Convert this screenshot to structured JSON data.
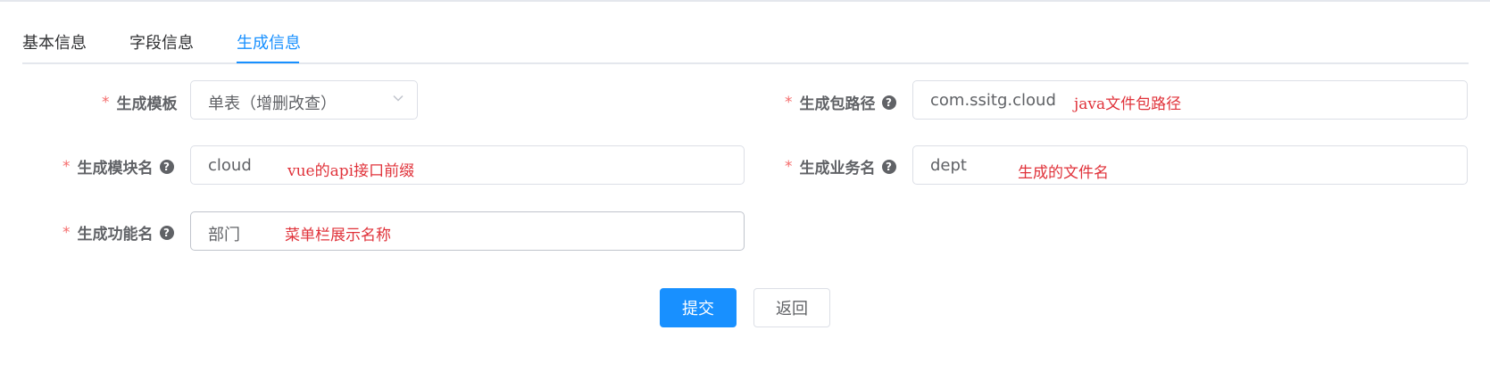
{
  "tabs": [
    {
      "label": "基本信息"
    },
    {
      "label": "字段信息"
    },
    {
      "label": "生成信息"
    }
  ],
  "active_tab": "生成信息",
  "form": {
    "required_mark": "*",
    "help_glyph": "?",
    "template": {
      "label": "生成模板",
      "value": "单表（增删改查）"
    },
    "package": {
      "label": "生成包路径",
      "value": "com.ssitg.cloud",
      "note": "java文件包路径"
    },
    "module": {
      "label": "生成模块名",
      "value": "cloud",
      "note": "vue的api接口前缀"
    },
    "business": {
      "label": "生成业务名",
      "value": "dept",
      "note": "生成的文件名"
    },
    "function": {
      "label": "生成功能名",
      "value": "部门",
      "note": "菜单栏展示名称"
    }
  },
  "buttons": {
    "submit": "提交",
    "back": "返回"
  },
  "colors": {
    "primary": "#1890ff",
    "required": "#f56c6c",
    "annotation": "#e0323a",
    "text": "#606266",
    "border": "#dcdfe6"
  }
}
